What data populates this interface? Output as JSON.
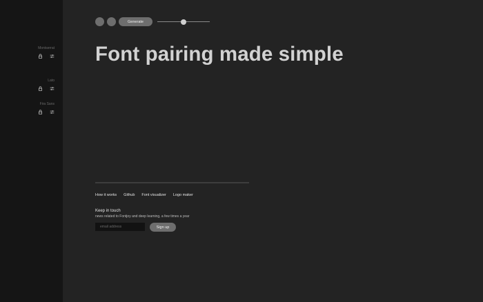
{
  "sidebar": {
    "fonts": [
      {
        "name": "Montserrat",
        "lock_icon": "lock-icon",
        "settings_icon": "sliders-icon"
      },
      {
        "name": "Lato",
        "lock_icon": "lock-icon",
        "settings_icon": "sliders-icon"
      },
      {
        "name": "Fira Sans",
        "lock_icon": "lock-icon",
        "settings_icon": "sliders-icon"
      }
    ]
  },
  "toolbar": {
    "generate_label": "Generate",
    "slider_value": 0.5
  },
  "main": {
    "headline": "Font pairing made simple"
  },
  "footer": {
    "links": [
      "How it works",
      "Github",
      "Font visualizer",
      "Logo maker"
    ],
    "newsletter_title": "Keep in touch",
    "newsletter_desc": "news related to Fontjoy and deep learning, a few times a year",
    "email_placeholder": "email address",
    "signup_label": "Sign up"
  },
  "colors": {
    "sidebar_bg": "#151515",
    "main_bg": "#232323",
    "button_bg": "#6e6e6e",
    "headline": "#d2d2d2"
  }
}
